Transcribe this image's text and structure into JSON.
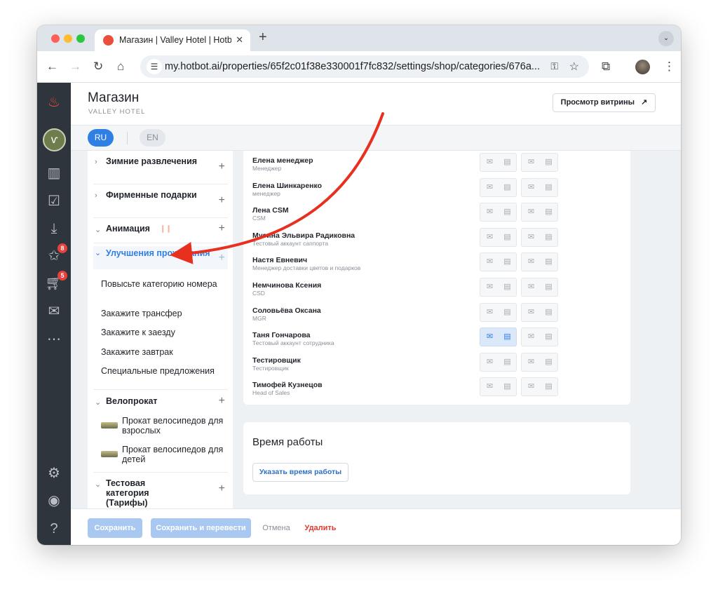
{
  "browser": {
    "tab_title": "Магазин | Valley Hotel | Hotbot",
    "url": "my.hotbot.ai/properties/65f2c01f38e330001f7fc832/settings/shop/categories/676a..."
  },
  "sidebar": {
    "badges": {
      "stars": "8",
      "cart": "5"
    }
  },
  "header": {
    "title": "Магазин",
    "subtitle": "VALLEY HOTEL",
    "preview_button": "Просмотр витрины",
    "preview_icon": "↗"
  },
  "languages": {
    "ru": "RU",
    "en": "EN"
  },
  "categories": {
    "c0": {
      "name": "Зимние развлечения"
    },
    "c1": {
      "name": "Фирменные подарки"
    },
    "c2": {
      "name": "Анимация"
    },
    "c3": {
      "name": "Улучшения проживания",
      "items": [
        "Повысьте категорию номера",
        "Закажите трансфер",
        "Закажите к заезду",
        "Закажите завтрак",
        "Специальные предложения"
      ]
    },
    "c4": {
      "name": "Велопрокат",
      "items": [
        "Прокат велосипедов для взрослых",
        "Прокат велосипедов для детей"
      ]
    },
    "c5": {
      "name": "Тестовая категория (Тарифы)"
    }
  },
  "staff": [
    {
      "name": "Елена менеджер",
      "role": "Менеджер"
    },
    {
      "name": "Елена Шинкаренко",
      "role": "менеджер"
    },
    {
      "name": "Лена CSM",
      "role": "CSM"
    },
    {
      "name": "Мусина Эльвира Радиковна",
      "role": "Тестовый аккаунт саппорта"
    },
    {
      "name": "Настя Евневич",
      "role": "Менеджер доставки цветов и подарков"
    },
    {
      "name": "Немчинова Ксения",
      "role": "CSD"
    },
    {
      "name": "Соловьёва Оксана",
      "role": "MGR"
    },
    {
      "name": "Таня Гончарова",
      "role": "Тестовый аккаунт сотрудника"
    },
    {
      "name": "Тестировщик",
      "role": "Тестировщик"
    },
    {
      "name": "Тимофей Кузнецов",
      "role": "Head of Sales"
    }
  ],
  "hours": {
    "title": "Время работы",
    "button": "Указать время работы"
  },
  "footer": {
    "save": "Сохранить",
    "save_translate": "Сохранить и перевести",
    "cancel": "Отмена",
    "delete": "Удалить"
  },
  "colors": {
    "accent": "#2f7fe5",
    "danger": "#e3382f",
    "sidebar": "#2f353d",
    "annotation_arrow": "#e8301f"
  }
}
